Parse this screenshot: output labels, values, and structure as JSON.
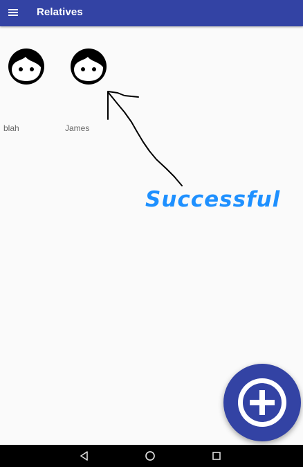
{
  "appbar": {
    "title": "Relatives",
    "menu_icon": "menu-icon",
    "background": "#3343a4"
  },
  "relatives": [
    {
      "name": "blah",
      "icon": "face-icon"
    },
    {
      "name": "James",
      "icon": "face-icon"
    }
  ],
  "annotation": {
    "text": "Successful",
    "color": "#1e90ff"
  },
  "fab": {
    "icon": "add-circle-icon",
    "color": "#3343a4"
  },
  "navbar": {
    "buttons": [
      "back-icon",
      "home-icon",
      "recents-icon"
    ]
  }
}
